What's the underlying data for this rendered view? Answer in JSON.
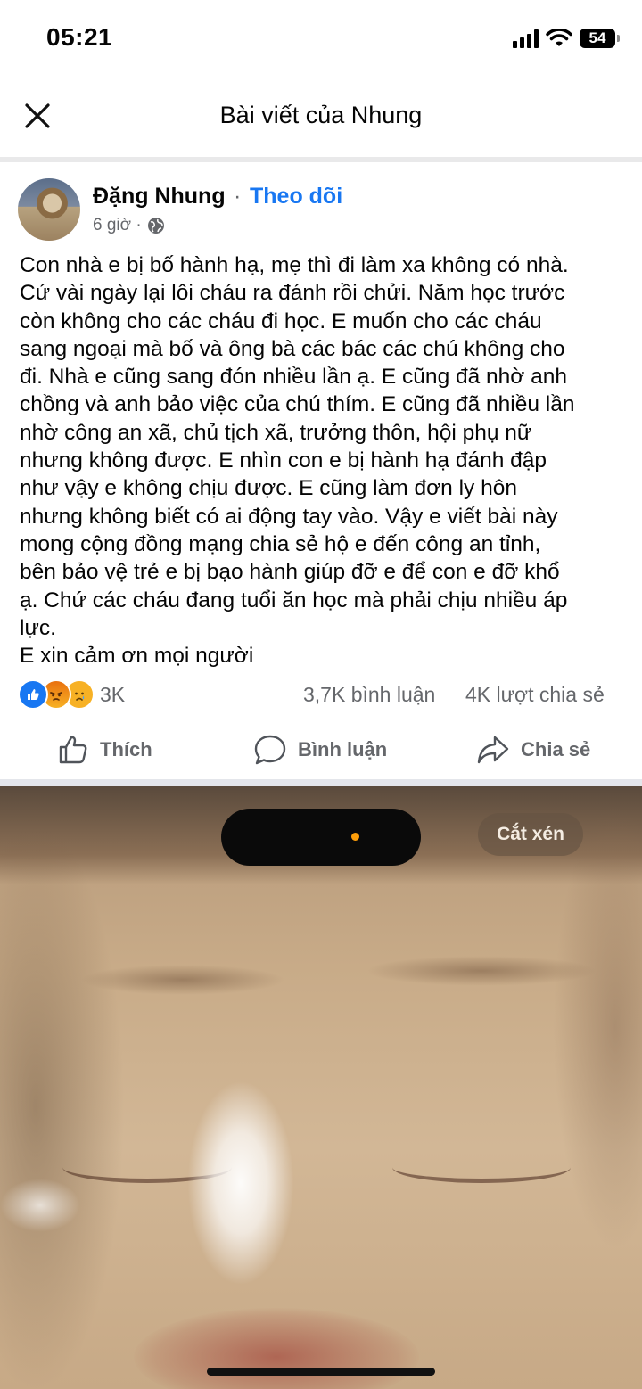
{
  "status_bar": {
    "time": "05:21",
    "battery": "54"
  },
  "header": {
    "title": "Bài viết của Nhung",
    "close_icon": "close-icon"
  },
  "post": {
    "author": "Đặng Nhung",
    "separator": "·",
    "follow_label": "Theo dõi",
    "time": "6 giờ ·",
    "privacy_icon": "globe-icon",
    "body_lines": [
      "Con nhà e bị bố hành hạ, mẹ thì đi làm xa không có nhà.",
      "Cứ vài ngày lại lôi cháu ra đánh rồi chửi. Năm học trước",
      "còn không cho các cháu đi học. E muốn cho các cháu",
      "sang ngoại mà bố và ông bà các bác các chú không cho",
      "đi. Nhà e cũng sang đón nhiều lần ạ. E cũng đã nhờ anh",
      "chồng và anh bảo việc của chú thím. E cũng đã nhiều lần",
      "nhờ công an xã, chủ tịch xã, trưởng thôn, hội phụ nữ",
      "nhưng không được. E nhìn con e bị hành hạ đánh đập",
      "như vậy e không chịu được. E cũng làm đơn ly hôn",
      "nhưng không biết có ai động tay vào. Vậy e viết bài này",
      "mong cộng đồng mạng chia sẻ hộ e đến công an tỉnh,",
      "bên bảo vệ trẻ e bị bạo hành giúp đỡ e để con e đỡ khổ",
      "ạ. Chứ các cháu đang tuổi ăn học mà phải chịu nhiều áp",
      "lực.",
      "E xin cảm ơn mọi người"
    ],
    "reactions": {
      "icons": [
        "like-icon",
        "angry-icon",
        "sad-icon"
      ],
      "count": "3K",
      "comments": "3,7K bình luận",
      "shares": "4K lượt chia sẻ"
    },
    "actions": {
      "like": "Thích",
      "comment": "Bình luận",
      "share": "Chia sẻ"
    }
  },
  "photo": {
    "crop_label": "Cắt xén"
  },
  "colors": {
    "accent": "#1877f2",
    "secondary_text": "#65676b",
    "like_blue": "#1877f2",
    "angry_orange": "#e9710f",
    "sad_yellow": "#f7b125"
  }
}
